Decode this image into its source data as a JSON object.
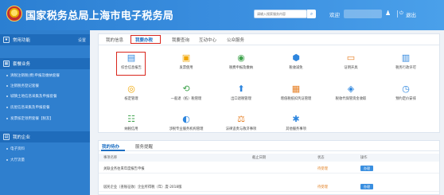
{
  "header": {
    "title": "国家税务总局上海市电子税务局",
    "search_placeholder": "请输入搜索服务内容",
    "welcome": "欢迎",
    "logout": "退出"
  },
  "sidebar": {
    "section1": {
      "title": "常用功能",
      "action": "设置"
    },
    "section2": {
      "title": "套餐业务",
      "items": [
        "清税注销税(费)申报及缴纳套餐",
        "注销税务登记套餐",
        "城镇土地信息采集及申报套餐",
        "房屋信息采集及申报套餐",
        "发票核定领用套餐【税友】"
      ]
    },
    "section3": {
      "title": "我的企业",
      "items": [
        "电子资料",
        "大厅流量"
      ]
    }
  },
  "main": {
    "tabs": [
      "我的信息",
      "我要办税",
      "我要查询",
      "互动中心",
      "公众服务"
    ],
    "active_tab": "我要办税",
    "tiles": [
      {
        "label": "综合信息报告",
        "icon": "report-icon"
      },
      {
        "label": "发票使用",
        "icon": "invoice-icon"
      },
      {
        "label": "税费申报及缴纳",
        "icon": "tax-declaration-icon"
      },
      {
        "label": "税收减免",
        "icon": "tax-relief-icon"
      },
      {
        "label": "证明开具",
        "icon": "certificate-icon"
      },
      {
        "label": "税务行政许可",
        "icon": "license-icon"
      },
      {
        "label": "核定管理",
        "icon": "assessment-icon"
      },
      {
        "label": "一般退（抵）税管理",
        "icon": "refund-icon"
      },
      {
        "label": "出口退税管理",
        "icon": "export-refund-icon"
      },
      {
        "label": "增值税抵扣凭证管理",
        "icon": "vat-voucher-icon"
      },
      {
        "label": "税收代保管资金收取",
        "icon": "custody-fund-icon"
      },
      {
        "label": "预约定价安排",
        "icon": "pricing-icon"
      },
      {
        "label": "纳税信用",
        "icon": "credit-icon"
      },
      {
        "label": "涉税专业服务机构管理",
        "icon": "agency-icon"
      },
      {
        "label": "法律追责与救济事项",
        "icon": "legal-icon"
      },
      {
        "label": "其他服务事项",
        "icon": "other-service-icon"
      }
    ]
  },
  "todo": {
    "tabs": [
      "我的待办",
      "服务提醒"
    ],
    "columns": [
      "事项名称",
      "截止日期",
      "状态",
      "操作"
    ],
    "rows": [
      {
        "name": "关联业务往来年度报告申报",
        "deadline": "",
        "status": "待受理",
        "action": "办理"
      },
      {
        "name": "居民企业（查账征收）企业所得税（年）度-2018版",
        "deadline": "",
        "status": "待受理",
        "action": "办理"
      }
    ]
  },
  "colors": {
    "header_blue": "#2b7fd2",
    "sidebar_blue": "#2f7fce",
    "highlight_red": "#d9261c",
    "status_orange": "#e07b1a",
    "button_blue": "#3a8fe0"
  }
}
